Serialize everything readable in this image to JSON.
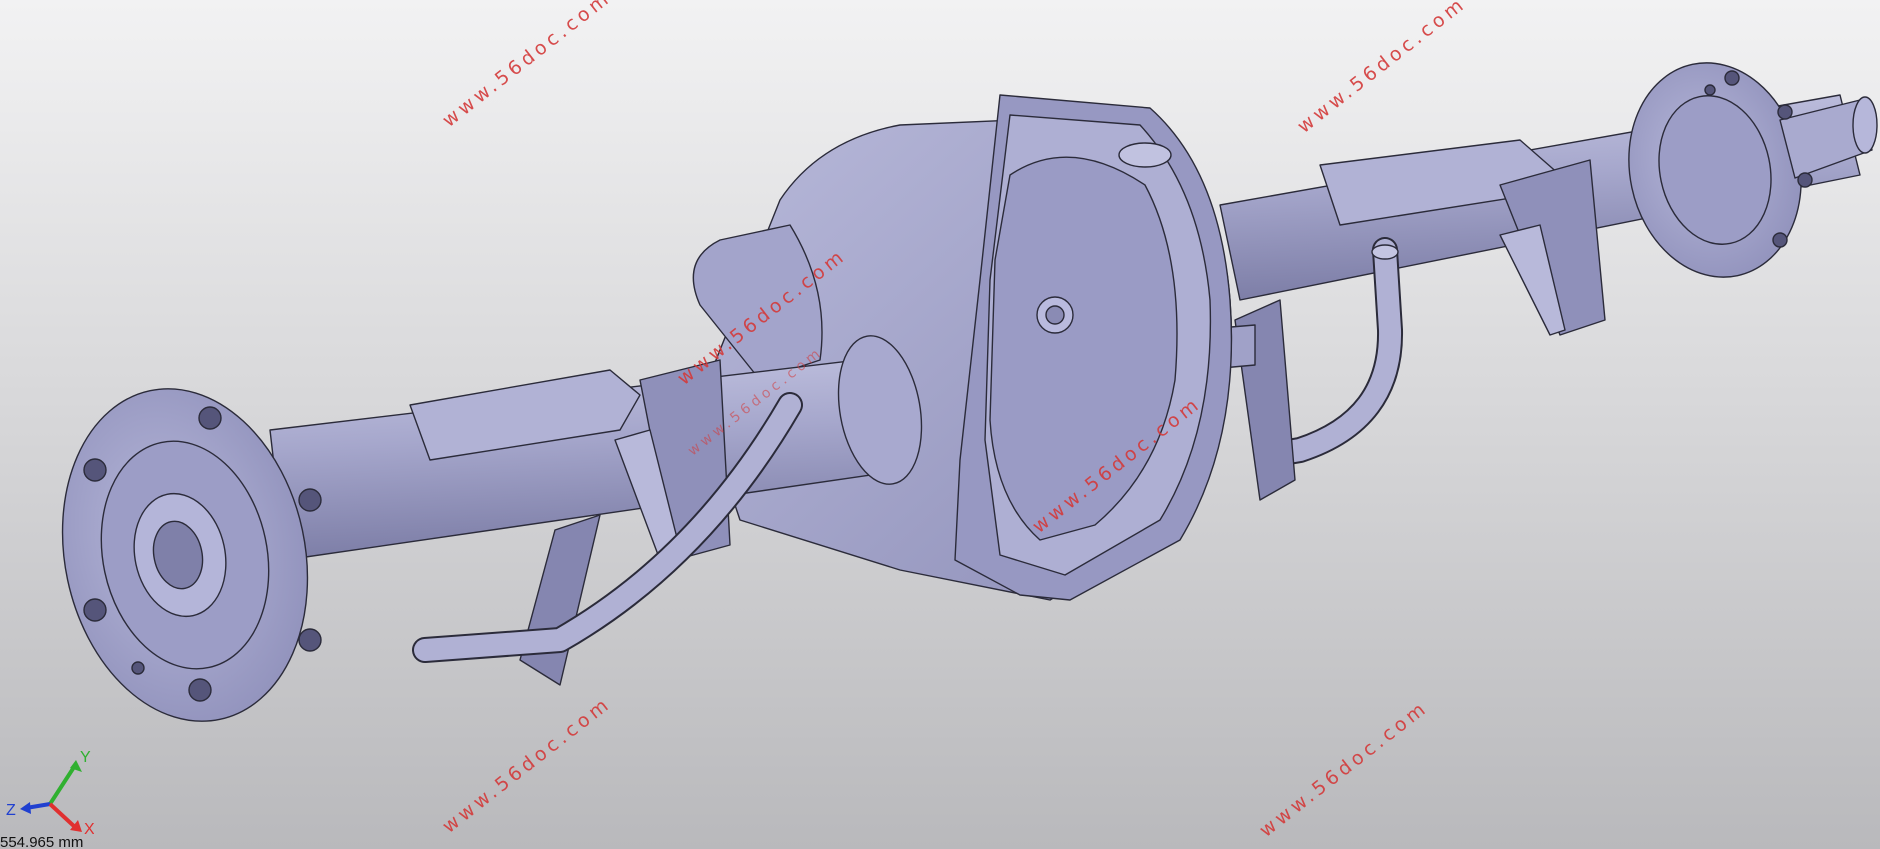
{
  "viewport": {
    "model": "rear-axle-assembly",
    "render_mode": "shaded-with-edges",
    "colors": {
      "background_top": "#f2f2f3",
      "background_bottom": "#b9b9bc",
      "body": "#a6a7cc",
      "body_dark": "#8384ad",
      "body_light": "#c4c5e2",
      "edge": "#2b2b3a",
      "watermark": "#d43a3a"
    }
  },
  "watermarks": [
    {
      "text": "www.56doc.com"
    },
    {
      "text": "www.56doc.com"
    },
    {
      "text": "www.56doc.com"
    },
    {
      "text": "www.56doc.com"
    },
    {
      "text": "www.56doc.com"
    },
    {
      "text": "www.56doc.com"
    },
    {
      "text": "www.56doc.com"
    }
  ],
  "triad": {
    "y_label": "Y",
    "z_label": "Z",
    "x_label": "X",
    "colors": {
      "x": "#e03030",
      "y": "#30b030",
      "z": "#2040d0"
    }
  },
  "scale": {
    "text": "554.965 mm"
  }
}
